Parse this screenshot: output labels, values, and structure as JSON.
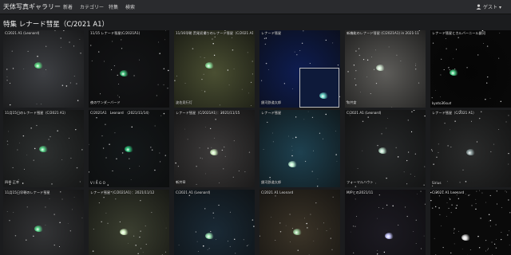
{
  "navbar": {
    "brand": "天体写真ギャラリー",
    "links": [
      "新着",
      "カテゴリー",
      "特集",
      "検索"
    ],
    "user": "ゲスト",
    "user_caret": "▾",
    "user_icon": "user-icon"
  },
  "page": {
    "title": "特集 レナード彗星（C/2021 A1）"
  },
  "tiles": [
    {
      "title": "C/2021 A1 (Leonard)",
      "credit": "",
      "bg": "#3e4044"
    },
    {
      "title": "11/15 レナード彗星(C/2021A1)",
      "credit": "夜のサンダーバード",
      "bg": "#131416"
    },
    {
      "title": "11/16早朝 荒尾初撮りのレナード彗星（C/2021 A1）",
      "credit": "波佐見行灯",
      "bg": "#4a4f32"
    },
    {
      "title": "レナード彗星",
      "credit": "銀河鉄道太郎",
      "bg": "#0e1d52"
    },
    {
      "title": "新機能のレナード彗星 (C/2021A1) in 2021 11",
      "credit": "和井倉",
      "bg": "#5e5d5a"
    },
    {
      "title": "レナード彗星とカルバーニール銀河",
      "credit": "kyoto36sun",
      "bg": "#050505"
    },
    {
      "title": "11月15日のレナード彗星（C/2021 A1）",
      "credit": "四季 正幸",
      "bg": "#2d3030"
    },
    {
      "title": "C/2021A1　Leonard　（2021/11/14）",
      "credit": "V I R G O",
      "bg": "#14181a"
    },
    {
      "title": "レナード彗星（C/2021A1）：2021/11/15",
      "credit": "斬井章",
      "bg": "#3c3a3a"
    },
    {
      "title": "レナード彗星",
      "credit": "銀河鉄道太郎",
      "bg": "#1e4150"
    },
    {
      "title": "C/2021 A1 (Leonard)",
      "credit": "フォーマルハウト",
      "bg": "#262829"
    },
    {
      "title": "レナード彗星（C/2021 A1）",
      "credit": "Sirius",
      "bg": "#2a2b2b"
    },
    {
      "title": "11月15日早朝のレナード彗星",
      "credit": "",
      "bg": "#333436"
    },
    {
      "title": "レナード彗星（C/2021A1）：2021/11/12",
      "credit": "",
      "bg": "#3b3f30"
    },
    {
      "title": "C/2021 A1 (Leonard)",
      "credit": "",
      "bg": "#1a2a36"
    },
    {
      "title": "C/2021 A1 Leonard",
      "credit": "",
      "bg": "#3b3428"
    },
    {
      "title": "M/Pとの2021/11",
      "credit": "",
      "bg": "#1c1a22"
    },
    {
      "title": "C/2021 A1 Leonard",
      "credit": "",
      "bg": "#0a0a0a"
    }
  ]
}
